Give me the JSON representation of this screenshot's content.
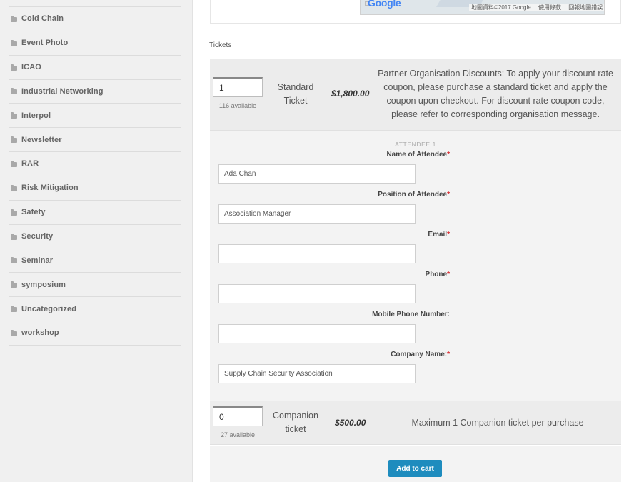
{
  "sidebar": {
    "categories": [
      {
        "label": "Cold Chain"
      },
      {
        "label": "Event Photo"
      },
      {
        "label": "ICAO"
      },
      {
        "label": "Industrial Networking"
      },
      {
        "label": "Interpol"
      },
      {
        "label": "Newsletter"
      },
      {
        "label": "RAR"
      },
      {
        "label": "Risk Mitigation"
      },
      {
        "label": "Safety"
      },
      {
        "label": "Security"
      },
      {
        "label": "Seminar"
      },
      {
        "label": "symposium"
      },
      {
        "label": "Uncategorized"
      },
      {
        "label": "workshop"
      }
    ],
    "icon": "folder-icon"
  },
  "map": {
    "logo": "Google",
    "attribution": [
      "地圖資料©2017 Google",
      "使用條款",
      "回報地圖錯誤"
    ]
  },
  "tickets": {
    "section_title": "Tickets",
    "standard": {
      "quantity": "1",
      "available": "116 available",
      "name": "Standard Ticket",
      "price": "$1,800.00",
      "description": "Partner Organisation Discounts: To apply your discount rate coupon, please purchase a standard ticket and apply the coupon upon checkout. For discount rate coupon code, please refer to corresponding organisation message."
    },
    "companion": {
      "quantity": "0",
      "available": "27 available",
      "name": "Companion ticket",
      "price": "$500.00",
      "description": "Maximum 1 Companion ticket per purchase"
    }
  },
  "attendee": {
    "heading": "ATTENDEE 1",
    "required_mark": "*",
    "fields": [
      {
        "label": "Name of Attendee",
        "required": true,
        "value": "Ada Chan"
      },
      {
        "label": "Position of Attendee",
        "required": true,
        "value": "Association Manager"
      },
      {
        "label": "Email",
        "required": true,
        "value": ""
      },
      {
        "label": "Phone",
        "required": true,
        "value": ""
      },
      {
        "label": "Mobile Phone Number:",
        "required": false,
        "value": ""
      },
      {
        "label": "Company Name:",
        "required": true,
        "value": "Supply Chain Security Association"
      }
    ]
  },
  "cart": {
    "button_label": "Add to cart"
  }
}
